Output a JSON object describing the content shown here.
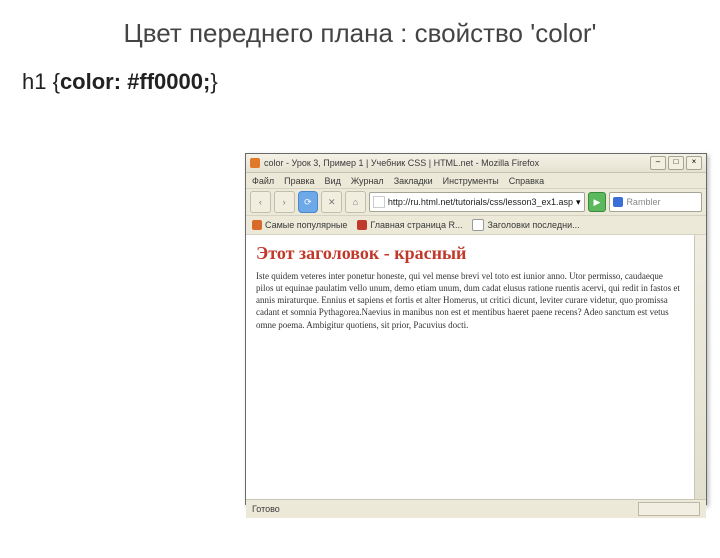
{
  "slide": {
    "title": "Цвет переднего плана : свойство 'color'",
    "code_prefix": "h1 {",
    "code_prop": "color: #ff0000;",
    "code_suffix": "}"
  },
  "browser": {
    "window_title": "color - Урок 3, Пример 1 | Учебник CSS | HTML.net - Mozilla Firefox",
    "menu": {
      "file": "Файл",
      "edit": "Правка",
      "view": "Вид",
      "history": "Журнал",
      "bookmarks": "Закладки",
      "tools": "Инструменты",
      "help": "Справка"
    },
    "nav": {
      "back": "‹",
      "forward": "›",
      "reload": "⟳",
      "stop": "✕",
      "home": "⌂",
      "go": "▶",
      "dropdown": "▾"
    },
    "url": "http://ru.html.net/tutorials/css/lesson3_ex1.asp",
    "search_placeholder": "Rambler",
    "bookmarks": {
      "b1": "Самые популярные",
      "b2": "Главная страница R...",
      "b3": "Заголовки последни..."
    },
    "page": {
      "heading": "Этот заголовок - красный",
      "paragraph": "Iste quidem veteres inter ponetur honeste, qui vel mense brevi vel toto est iunior anno. Utor permisso, caudaeque pilos ut equinae paulatim vello unum, demo etiam unum, dum cadat elusus ratione ruentis acervi, qui redit in fastos et annis miraturque. Ennius et sapiens et fortis et alter Homerus, ut critici dicunt, leviter curare videtur, quo promissa cadant et somnia Pythagorea.Naevius in manibus non est et mentibus haeret paene recens? Adeo sanctum est vetus omne poema. Ambigitur quotiens, sit prior, Pacuvius docti."
    },
    "status": "Готово"
  }
}
